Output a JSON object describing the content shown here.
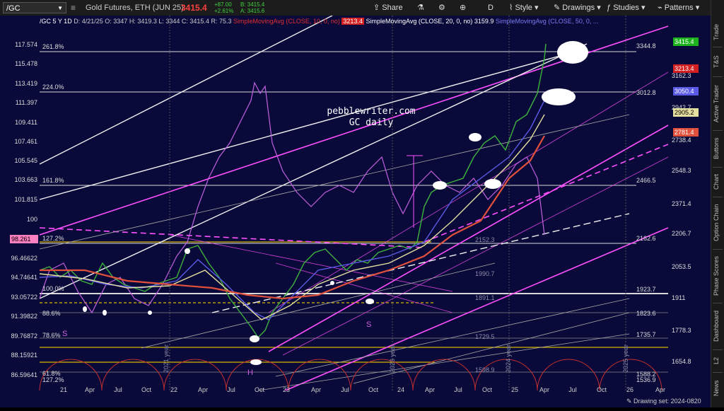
{
  "toolbar": {
    "symbol": "/GC",
    "instrument": "Gold Futures, ETH (JUN 25)",
    "last_price": "3415.4",
    "change": "+87.00",
    "change_pct": "+2.61%",
    "bid": "B: 3415.4",
    "ask": "A: 3415.6",
    "share_label": "Share",
    "period": "D",
    "style_label": "Style",
    "drawings_label": "Drawings",
    "studies_label": "Studies",
    "patterns_label": "Patterns"
  },
  "header": {
    "symbol_period": "/GC 5 Y 1D",
    "date": "D: 4/21/25",
    "open": "O: 3347",
    "high": "H: 3419.3",
    "low": "L: 3344",
    "close": "C: 3415.4",
    "range": "R: 75.3",
    "sma10": "SimpleMovingAvg (CLOSE, 10, 0, no)",
    "sma10_val": "3213.4",
    "sma20": "SimpleMovingAvg (CLOSE, 20, 0, no)",
    "sma20_val": "3159.9",
    "sma50": "SimpleMovingAvg (CLOSE, 50, 0, ..."
  },
  "watermark": {
    "line1": "pebblewriter.com",
    "line2": "GC daily"
  },
  "left_axis": [
    "117.574",
    "115.478",
    "113.419",
    "111.397",
    "109.411",
    "107.461",
    "105.545",
    "103.663",
    "101.815",
    "100",
    "98.261",
    "96.46622",
    "94.74641",
    "93.05722",
    "91.39822",
    "89.76872",
    "88.15921",
    "86.59641"
  ],
  "left_highlight": "98.261",
  "right_axis": [
    "3344.8",
    "3162.3",
    "3012.8",
    "2942.7",
    "2738.4",
    "2548.3",
    "2466.5",
    "2371.4",
    "2206.7",
    "2162.6",
    "2053.5",
    "1923.7",
    "1911",
    "1823.6",
    "1778.3",
    "1735.7",
    "1654.8",
    "1588.2",
    "1536.9"
  ],
  "right_badges": [
    {
      "label": "3415.4",
      "color": "#1db31d"
    },
    {
      "label": "3213.4",
      "color": "#d42020"
    },
    {
      "label": "3050.4",
      "color": "#5a5ae6"
    },
    {
      "label": "2905.2",
      "color": "#e6e0a0"
    },
    {
      "label": "2781.4",
      "color": "#e0503c"
    }
  ],
  "fib_labels": [
    "261.8%",
    "224.0%",
    "161.8%",
    "127.2%",
    "100.0%",
    "88.6%",
    "78.6%",
    "61.8%",
    "127.2%"
  ],
  "level_labels": [
    "2152.3",
    "1990.7",
    "1891.1",
    "1729.5",
    "1598.9"
  ],
  "markers": [
    "S",
    "S",
    "H",
    "S"
  ],
  "x_axis": [
    "21",
    "Apr",
    "Jul",
    "Oct",
    "22",
    "Apr",
    "Jul",
    "Oct",
    "23",
    "Apr",
    "Jul",
    "Oct",
    "24",
    "Apr",
    "Jul",
    "Oct",
    "25",
    "Apr",
    "Jul",
    "Oct",
    "26",
    "Apr"
  ],
  "cycle_labels": [
    "2021 year",
    "2023 year",
    "2024 year",
    "2025 year"
  ],
  "side_tabs": [
    "Trade",
    "T&S",
    "Active Trader",
    "Buttons",
    "Chart",
    "Option Chain",
    "Phase Scores",
    "Dashboard",
    "L2",
    "News"
  ],
  "drawing_set": "Drawing set: 2024-0820",
  "colors": {
    "background": "#0a0a3a",
    "price_line": "#c060e0",
    "sma10": "#d42020",
    "sma20": "#5a5ae6",
    "sma50": "#e6e0a0",
    "sma200": "#e0503c",
    "channel": "#ff50ff",
    "fib": "#cccccc"
  }
}
